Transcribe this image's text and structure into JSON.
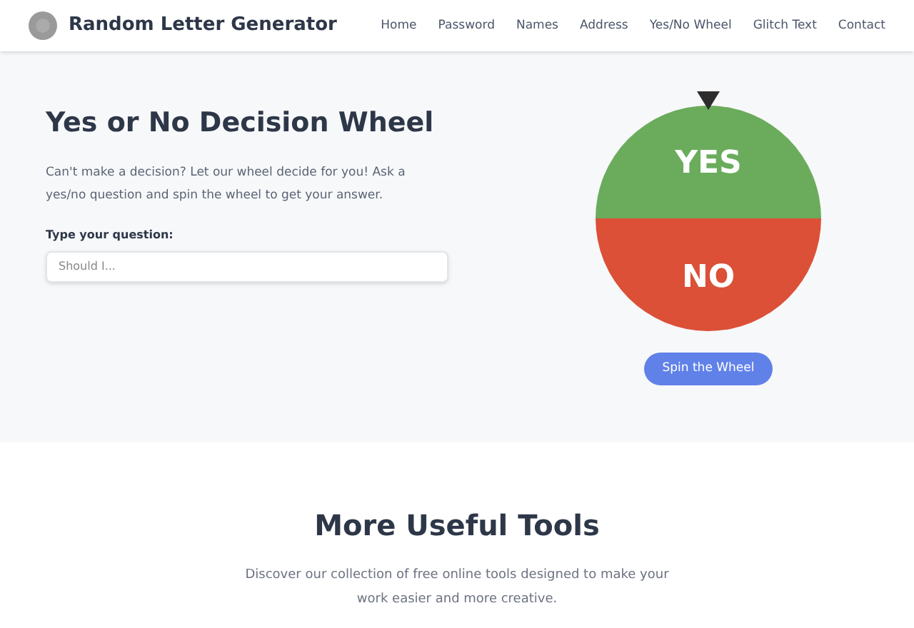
{
  "header": {
    "brand": "Random Letter Generator",
    "nav": [
      "Home",
      "Password",
      "Names",
      "Address",
      "Yes/No Wheel",
      "Glitch Text",
      "Contact"
    ]
  },
  "hero": {
    "title": "Yes or No Decision Wheel",
    "description": "Can't make a decision? Let our wheel decide for you! Ask a yes/no question and spin the wheel to get your answer.",
    "field": {
      "label": "Type your question:",
      "placeholder": "Should I..."
    },
    "wheel": {
      "segments": [
        {
          "label": "YES",
          "color": "#6aac5b"
        },
        {
          "label": "NO",
          "color": "#db5037"
        }
      ]
    },
    "button": "Spin the Wheel"
  },
  "tools": {
    "title": "More Useful Tools",
    "description": "Discover our collection of free online tools designed to make your work easier and more creative."
  }
}
